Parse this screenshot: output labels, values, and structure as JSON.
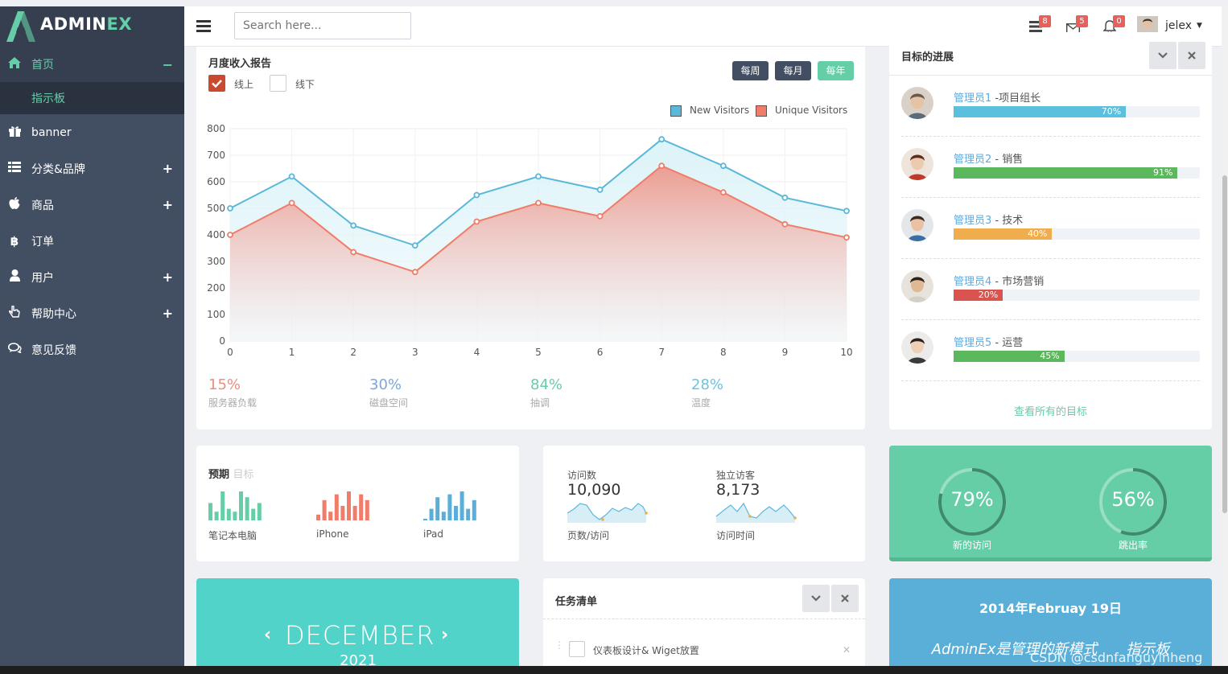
{
  "app": {
    "name_prefix": "ADMIN",
    "name_suffix": "EX"
  },
  "sidebar": {
    "items": [
      {
        "label": "首页",
        "icon": "home-icon",
        "expander": "−"
      },
      {
        "label": "指示板"
      },
      {
        "label": "banner",
        "icon": "gift-icon"
      },
      {
        "label": "分类&品牌",
        "icon": "list-icon",
        "expander": "+"
      },
      {
        "label": "商品",
        "icon": "apple-icon",
        "expander": "+"
      },
      {
        "label": "订单",
        "icon": "bitcoin-icon"
      },
      {
        "label": "用户",
        "icon": "user-icon",
        "expander": "+"
      },
      {
        "label": "帮助中心",
        "icon": "hand-pointer-icon",
        "expander": "+"
      },
      {
        "label": "意见反馈",
        "icon": "comments-icon"
      }
    ]
  },
  "topbar": {
    "search_placeholder": "Search here...",
    "tasks_count": "8",
    "mail_count": "5",
    "notif_count": "0",
    "username": "jelex"
  },
  "revenue": {
    "title": "月度收入报告",
    "check_online": "线上",
    "check_offline": "线下",
    "btn_week": "每周",
    "btn_month": "每月",
    "btn_year": "每年",
    "stats": [
      {
        "value": "15%",
        "label": "服务器负载",
        "color": "#f08c7a"
      },
      {
        "value": "30%",
        "label": "磁盘空间",
        "color": "#7aa8dc"
      },
      {
        "value": "84%",
        "label": "抽调",
        "color": "#65cea7"
      },
      {
        "value": "28%",
        "label": "温度",
        "color": "#6cc3e0"
      }
    ]
  },
  "chart_data": {
    "type": "area",
    "x": [
      0,
      1,
      2,
      3,
      4,
      5,
      6,
      7,
      8,
      9,
      10
    ],
    "series": [
      {
        "name": "New Visitors",
        "color": "#5bb8d8",
        "values": [
          500,
          620,
          435,
          360,
          550,
          620,
          570,
          760,
          660,
          540,
          490
        ]
      },
      {
        "name": "Unique Visitors",
        "color": "#f07d6a",
        "values": [
          400,
          520,
          335,
          260,
          450,
          520,
          470,
          660,
          560,
          440,
          390
        ]
      }
    ],
    "ylim": [
      0,
      800
    ],
    "yticks": [
      0,
      100,
      200,
      300,
      400,
      500,
      600,
      700,
      800
    ],
    "grid": true,
    "legend": "top-right"
  },
  "goals": {
    "title": "目标的进展",
    "items": [
      {
        "name": "管理员1",
        "role": " -项目组长",
        "pct": 70,
        "pct_label": "70%",
        "color": "#5bc0de"
      },
      {
        "name": "管理员2",
        "role": " - 销售",
        "pct": 91,
        "pct_label": "91%",
        "color": "#5cb85c"
      },
      {
        "name": "管理员3",
        "role": " - 技术",
        "pct": 40,
        "pct_label": "40%",
        "color": "#f0ad4e"
      },
      {
        "name": "管理员4",
        "role": " - 市场营销",
        "pct": 20,
        "pct_label": "20%",
        "color": "#d9534f"
      },
      {
        "name": "管理员5",
        "role": " - 运营",
        "pct": 45,
        "pct_label": "45%",
        "color": "#5cb85c"
      }
    ],
    "view_all": "查看所有的目标"
  },
  "forecast": {
    "title": "预期",
    "subtitle": "目标",
    "items": [
      {
        "label": "笔记本电脑",
        "color": "#65cea7",
        "bars": [
          0.6,
          0.3,
          1,
          0.4,
          0.3,
          1,
          0.8,
          0.4,
          0.6
        ]
      },
      {
        "label": "iPhone",
        "color": "#f07d6a",
        "bars": [
          0.2,
          0.7,
          0.3,
          0.9,
          0.5,
          1,
          0.5,
          0.9,
          0.7
        ]
      },
      {
        "label": "iPad",
        "color": "#5aafd9",
        "bars": [
          0.05,
          0.4,
          0.8,
          0.3,
          0.9,
          0.5,
          1,
          0.4,
          0.7
        ]
      }
    ]
  },
  "visits": {
    "a_title": "访问数",
    "a_value": "10,090",
    "a_label": "页数/访问",
    "b_title": "独立访客",
    "b_value": "8,173",
    "b_label": "访问时间"
  },
  "rings": [
    {
      "value": "79%",
      "pct": 79,
      "label": "新的访问"
    },
    {
      "value": "56%",
      "pct": 56,
      "label": "跳出率"
    }
  ],
  "calendar": {
    "month": "DECEMBER",
    "year": "2021"
  },
  "tasks": {
    "title": "任务清单",
    "items": [
      "仪表板设计& Wiget放置"
    ]
  },
  "blue_card": {
    "date": "2014年Februay 19日",
    "text": "AdminEx是管理的新模式　　指示板"
  },
  "watermark": "CSDN @csdnfanguyinheng"
}
